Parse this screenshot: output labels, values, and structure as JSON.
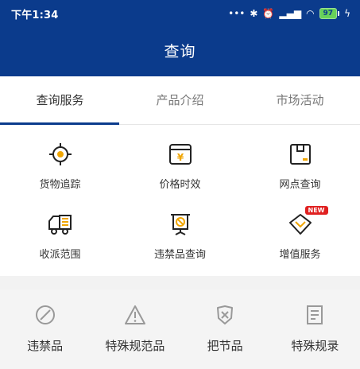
{
  "status_bar": {
    "time": "下午1:34",
    "battery": "97",
    "icons": [
      "more-dots-icon",
      "bluetooth-icon",
      "alarm-icon",
      "signal-icon",
      "wifi-icon",
      "battery-icon",
      "charging-icon"
    ]
  },
  "header": {
    "title": "查询"
  },
  "tabs": [
    {
      "label": "查询服务",
      "active": true
    },
    {
      "label": "产品介绍",
      "active": false
    },
    {
      "label": "市场活动",
      "active": false
    }
  ],
  "services": [
    {
      "label": "货物追踪",
      "icon": "target-icon"
    },
    {
      "label": "价格时效",
      "icon": "price-icon"
    },
    {
      "label": "网点查询",
      "icon": "box-icon"
    },
    {
      "label": "收派范围",
      "icon": "truck-icon"
    },
    {
      "label": "违禁品查询",
      "icon": "prohibited-board-icon"
    },
    {
      "label": "增值服务",
      "icon": "value-added-icon",
      "badge": "NEW"
    }
  ],
  "categories": [
    {
      "label": "违禁品",
      "icon": "prohibited-icon"
    },
    {
      "label": "特殊规范品",
      "icon": "warning-icon"
    },
    {
      "label": "把节品",
      "icon": "shield-x-icon"
    },
    {
      "label": "特殊规录",
      "icon": "document-icon"
    }
  ],
  "colors": {
    "brand": "#0b3b8c",
    "accent": "#f0a500",
    "badge": "#e02020"
  }
}
